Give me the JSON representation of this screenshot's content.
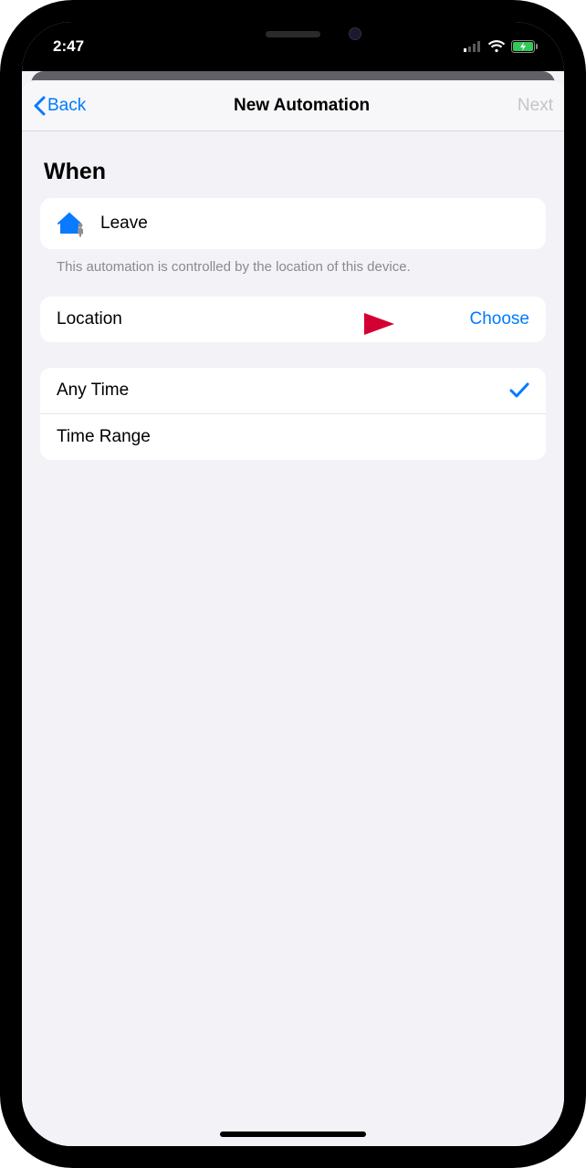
{
  "statusbar": {
    "time": "2:47"
  },
  "nav": {
    "back": "Back",
    "title": "New Automation",
    "next": "Next"
  },
  "section": {
    "when": "When"
  },
  "trigger": {
    "label": "Leave",
    "footnote": "This automation is controlled by the location of this device."
  },
  "location": {
    "label": "Location",
    "action": "Choose"
  },
  "time": {
    "any": "Any Time",
    "range": "Time Range",
    "selected": "any"
  }
}
